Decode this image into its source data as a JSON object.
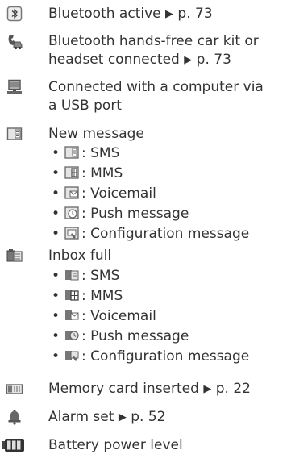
{
  "rows": {
    "bluetooth": {
      "text": "Bluetooth active",
      "arrow": "▶",
      "ref": "p. 73",
      "icon": "bluetooth-icon"
    },
    "handsfree": {
      "line1": "Bluetooth hands-free car kit or",
      "line2": "headset connected",
      "arrow": "▶",
      "ref": "p. 73",
      "icon": "car-kit-icon"
    },
    "usb": {
      "line1": "Connected with a computer via",
      "line2": "a USB port",
      "icon": "computer-icon"
    },
    "new_message": {
      "text": "New message",
      "icon": "message-icon",
      "items": [
        {
          "bullet": "•",
          "label": ": SMS",
          "icon": "sms-icon"
        },
        {
          "bullet": "•",
          "label": ": MMS",
          "icon": "mms-icon"
        },
        {
          "bullet": "•",
          "label": ": Voicemail",
          "icon": "voicemail-icon"
        },
        {
          "bullet": "•",
          "label": ": Push message",
          "icon": "push-message-icon"
        },
        {
          "bullet": "•",
          "label": ": Configuration message",
          "icon": "configuration-message-icon"
        }
      ]
    },
    "inbox_full": {
      "text": "Inbox full",
      "icon": "inbox-full-icon",
      "items": [
        {
          "bullet": "•",
          "label": ": SMS",
          "icon": "inbox-sms-icon"
        },
        {
          "bullet": "•",
          "label": ": MMS",
          "icon": "inbox-mms-icon"
        },
        {
          "bullet": "•",
          "label": ": Voicemail",
          "icon": "inbox-voicemail-icon"
        },
        {
          "bullet": "•",
          "label": ": Push message",
          "icon": "inbox-push-icon"
        },
        {
          "bullet": "•",
          "label": ": Configuration message",
          "icon": "inbox-config-icon"
        }
      ]
    },
    "memory": {
      "text": "Memory card inserted",
      "arrow": "▶",
      "ref": "p. 22",
      "icon": "memory-card-icon"
    },
    "alarm": {
      "text": "Alarm set",
      "arrow": "▶",
      "ref": "p. 52",
      "icon": "bell-icon"
    },
    "battery": {
      "text": "Battery power level",
      "icon": "battery-icon"
    }
  },
  "colors": {
    "text": "#333333",
    "icon_gray": "#6f6f6f",
    "icon_light": "#dcdcdc"
  }
}
